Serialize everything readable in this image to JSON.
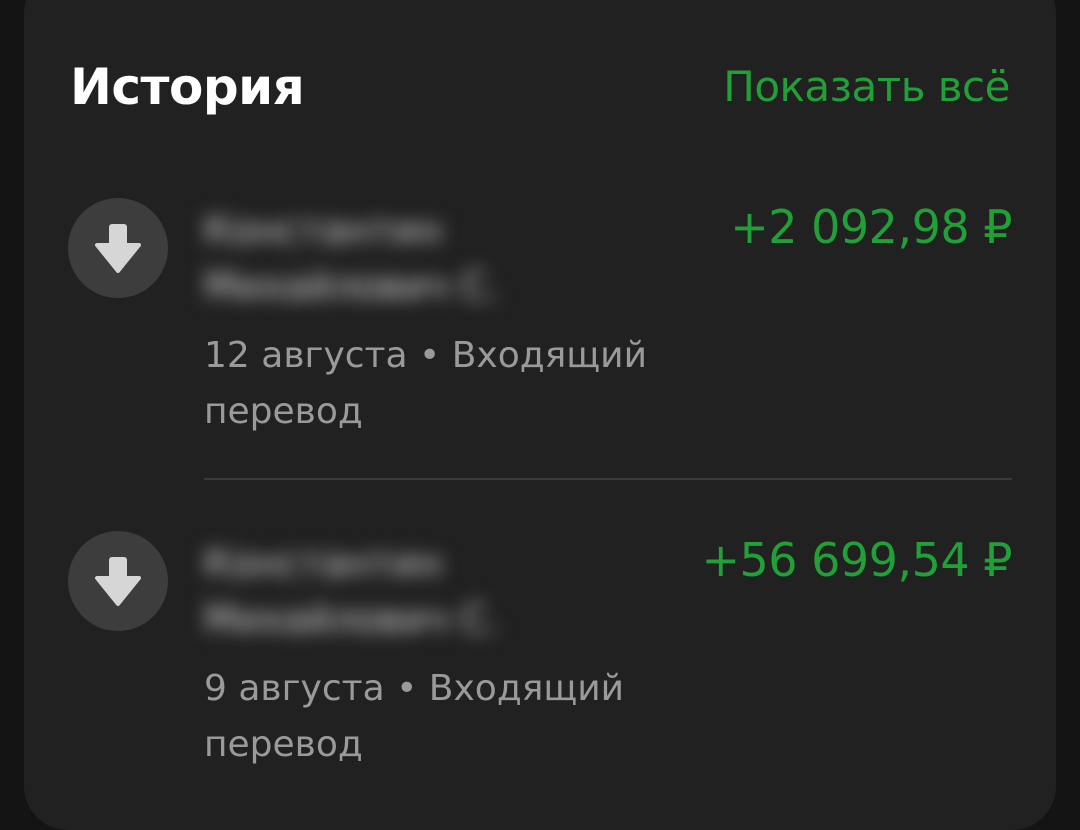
{
  "history": {
    "title": "История",
    "show_all": "Показать всё"
  },
  "transactions": [
    {
      "icon": "arrow-down-icon",
      "name": "Константин Михайлович С.",
      "date": "12 августа",
      "type": "Входящий перевод",
      "amount": "+2 092,98 ₽"
    },
    {
      "icon": "arrow-down-icon",
      "name": "Константин Михайлович С.",
      "date": "9 августа",
      "type": "Входящий перевод",
      "amount": "+56 699,54 ₽"
    }
  ],
  "colors": {
    "accent": "#21a038",
    "card_background": "#212121",
    "page_background": "#141414",
    "icon_background": "#3d3d3d"
  }
}
